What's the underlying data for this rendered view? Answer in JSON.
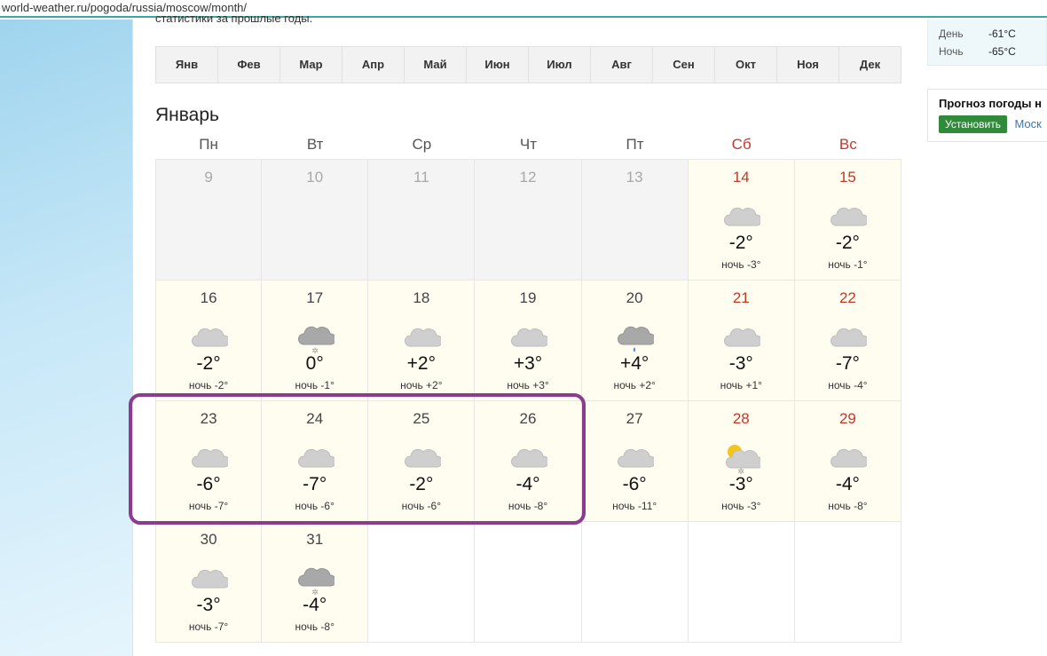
{
  "address_bar": {
    "url": "world-weather.ru/pogoda/russia/moscow/month/"
  },
  "intro_text": "статистики за прошлые годы.",
  "months": [
    "Янв",
    "Фев",
    "Мар",
    "Апр",
    "Май",
    "Июн",
    "Июл",
    "Авг",
    "Сен",
    "Окт",
    "Ноя",
    "Дек"
  ],
  "calendar": {
    "title": "Январь",
    "weekdays": [
      "Пн",
      "Вт",
      "Ср",
      "Чт",
      "Пт",
      "Сб",
      "Вс"
    ],
    "days": [
      {
        "d": "9",
        "state": "past"
      },
      {
        "d": "10",
        "state": "past"
      },
      {
        "d": "11",
        "state": "past"
      },
      {
        "d": "12",
        "state": "past"
      },
      {
        "d": "13",
        "state": "past"
      },
      {
        "d": "14",
        "weekend": true,
        "icon": "cloud",
        "temp": "-2°",
        "night": "ночь -3°"
      },
      {
        "d": "15",
        "weekend": true,
        "icon": "cloud",
        "temp": "-2°",
        "night": "ночь -1°"
      },
      {
        "d": "16",
        "icon": "cloud",
        "temp": "-2°",
        "night": "ночь -2°"
      },
      {
        "d": "17",
        "icon": "cloud-snow",
        "temp": "0°",
        "night": "ночь -1°"
      },
      {
        "d": "18",
        "icon": "cloud",
        "temp": "+2°",
        "night": "ночь +2°"
      },
      {
        "d": "19",
        "icon": "cloud",
        "temp": "+3°",
        "night": "ночь +3°"
      },
      {
        "d": "20",
        "icon": "cloud-rain",
        "temp": "+4°",
        "night": "ночь +2°"
      },
      {
        "d": "21",
        "weekend": true,
        "icon": "cloud",
        "temp": "-3°",
        "night": "ночь +1°"
      },
      {
        "d": "22",
        "weekend": true,
        "icon": "cloud",
        "temp": "-7°",
        "night": "ночь -4°"
      },
      {
        "d": "23",
        "icon": "cloud",
        "temp": "-6°",
        "night": "ночь -7°"
      },
      {
        "d": "24",
        "icon": "cloud",
        "temp": "-7°",
        "night": "ночь -6°"
      },
      {
        "d": "25",
        "icon": "cloud",
        "temp": "-2°",
        "night": "ночь -6°"
      },
      {
        "d": "26",
        "icon": "cloud",
        "temp": "-4°",
        "night": "ночь -8°"
      },
      {
        "d": "27",
        "icon": "cloud",
        "temp": "-6°",
        "night": "ночь -11°"
      },
      {
        "d": "28",
        "weekend": true,
        "icon": "sun-cloud-snow",
        "temp": "-3°",
        "night": "ночь -3°"
      },
      {
        "d": "29",
        "weekend": true,
        "icon": "cloud",
        "temp": "-4°",
        "night": "ночь -8°"
      },
      {
        "d": "30",
        "icon": "cloud",
        "temp": "-3°",
        "night": "ночь -7°"
      },
      {
        "d": "31",
        "icon": "cloud-snow",
        "temp": "-4°",
        "night": "ночь -8°"
      },
      {
        "state": "empty"
      },
      {
        "state": "empty"
      },
      {
        "state": "empty"
      },
      {
        "state": "empty"
      },
      {
        "state": "empty"
      }
    ]
  },
  "sidebar": {
    "day_label": "День",
    "day_value": "-61°C",
    "night_label": "Ночь",
    "night_value": "-65°C",
    "forecast_title": "Прогноз погоды н",
    "install_button": "Установить",
    "city_link": "Моск"
  },
  "colors": {
    "weekend": "#c0392b",
    "highlight": "#8d3b91",
    "install": "#2f8a3a"
  }
}
